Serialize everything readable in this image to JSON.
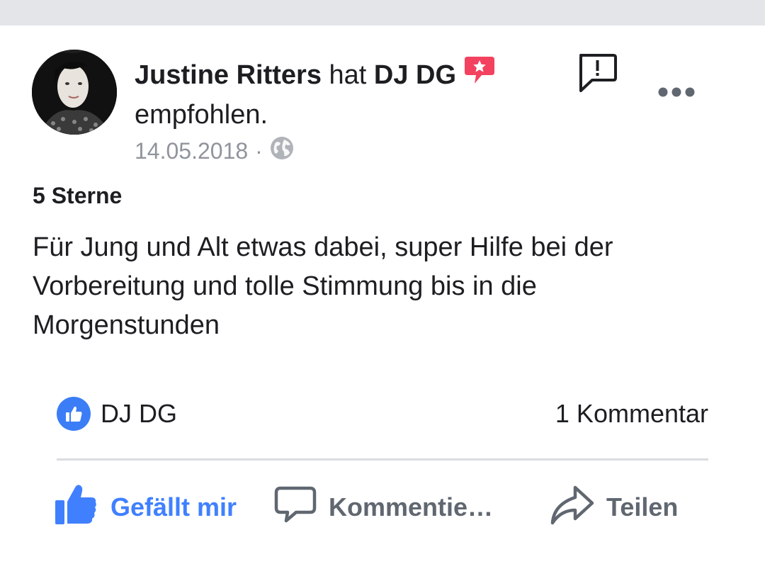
{
  "post": {
    "author": "Justine Ritters",
    "verb": "hat",
    "page": "DJ DG",
    "suffix": "empfohlen.",
    "date": "14.05.2018",
    "separator": "·",
    "privacy_icon": "globe-icon",
    "rating": "5 Sterne",
    "review_text": "Für Jung und Alt etwas dabei, super Hilfe bei der Vorbereitung und tolle Stimmung bis in die Morgenstunden"
  },
  "reactions": {
    "liker": "DJ DG",
    "comments": "1 Kommentar"
  },
  "actions": {
    "like": "Gefällt mir",
    "comment": "Kommentie…",
    "share": "Teilen"
  },
  "colors": {
    "accent": "#4080ff",
    "recommend_badge": "#f3425f",
    "muted": "#90949c"
  }
}
